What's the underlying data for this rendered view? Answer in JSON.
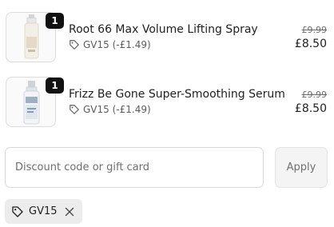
{
  "line_items": [
    {
      "quantity": "1",
      "title": "Root 66 Max Volume Lifting Spray",
      "discount_code": "GV15 (-£1.49)",
      "original_price": "£9.99",
      "price": "£8.50",
      "thumbnail_icon": "spray-bottle-image"
    },
    {
      "quantity": "1",
      "title": "Frizz Be Gone Super-Smoothing Serum",
      "discount_code": "GV15 (-£1.49)",
      "original_price": "£9.99",
      "price": "£8.50",
      "thumbnail_icon": "serum-bottle-image"
    }
  ],
  "discount_form": {
    "placeholder": "Discount code or gift card",
    "value": "",
    "apply_label": "Apply"
  },
  "applied_code": {
    "label": "GV15",
    "icon": "tag-icon",
    "remove_icon": "close-icon"
  },
  "colors": {
    "badge": "#111111",
    "chip_bg": "#ececec",
    "apply_bg": "#f4f4f4"
  }
}
